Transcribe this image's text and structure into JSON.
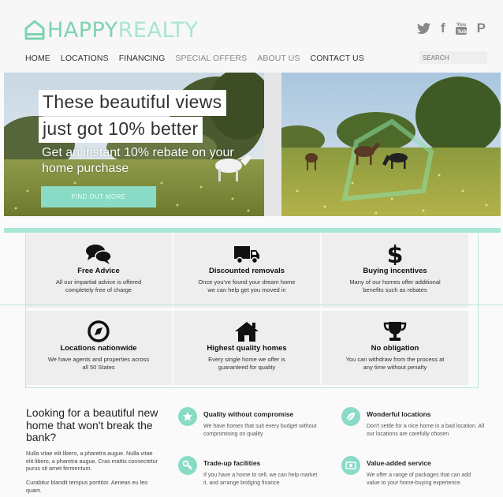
{
  "brand": {
    "part1": "HAPPY",
    "part2": "REALTY",
    "accent": "#7ed3b2"
  },
  "social": [
    {
      "name": "twitter-icon",
      "glyph": "🐦"
    },
    {
      "name": "facebook-icon",
      "glyph": "f"
    },
    {
      "name": "youtube-icon",
      "glyph": "▶"
    },
    {
      "name": "pinterest-icon",
      "glyph": "P"
    }
  ],
  "nav": {
    "home": "HOME",
    "locations": "LOCATIONS",
    "financing": "FINANCING",
    "special_offers": "SPECIAL OFFERS",
    "about_us": "ABOUT US",
    "contact_us": "CONTACT US"
  },
  "search": {
    "placeholder": "SEARCH"
  },
  "hero": {
    "headline_1": "These beautiful views",
    "headline_2": "just got 10% better",
    "sub": "Get an instant 10% rebate on your home purchase",
    "button": "FIND OUT MORE"
  },
  "features": [
    {
      "title": "Free Advice",
      "desc": "All our impartial advice is offered completely free of charge"
    },
    {
      "title": "Discounted removals",
      "desc": "Once you've found your dream home we can help get you moved in"
    },
    {
      "title": "Buying incentives",
      "desc": "Many of our homes offer additional benefits such as rebates"
    },
    {
      "title": "Locations nationwide",
      "desc": "We have agents and properties across all 50 States"
    },
    {
      "title": "Highest quality homes",
      "desc": "Every single home we offer is guaranteed for quality"
    },
    {
      "title": "No obligation",
      "desc": "You can withdraw from the process at any time without penalty"
    }
  ],
  "bottom": {
    "title": "Looking for a beautiful new home that won't break the bank?",
    "p1": "Nulla vitae elit libero, a pharetra augue. Nulla vitae elit libero, a pharetra augue. Cras mattis consectetur purus sit amet fermentum.",
    "p2": "Curabitur blandit tempus porttitor. Aenean eu leo quam.",
    "items": [
      {
        "title": "Quality without compromise",
        "desc": "We have homes that suit every budget without compromising on quality"
      },
      {
        "title": "Wonderful locations",
        "desc": "Don't settle for a nice home in a bad location. All our locations are carefully chosen"
      },
      {
        "title": "Trade-up facilities",
        "desc": "If you have a home to sell, we can help market it, and arrange bridging finance"
      },
      {
        "title": "Value-added service",
        "desc": "We offer a range of packages that can add value to your home-buying experience."
      }
    ]
  }
}
